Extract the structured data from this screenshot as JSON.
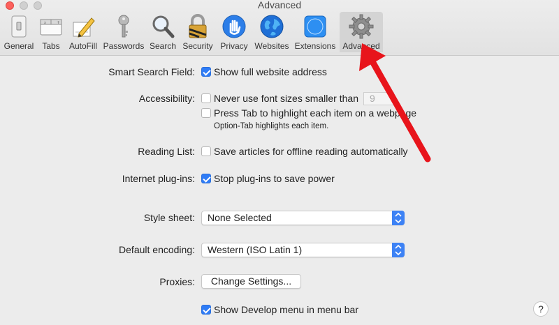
{
  "window": {
    "title": "Advanced"
  },
  "toolbar": {
    "tabs": [
      {
        "label": "General",
        "icon": "general-switch-icon"
      },
      {
        "label": "Tabs",
        "icon": "tabs-icon"
      },
      {
        "label": "AutoFill",
        "icon": "autofill-pencil-icon"
      },
      {
        "label": "Passwords",
        "icon": "key-icon"
      },
      {
        "label": "Search",
        "icon": "magnifier-icon"
      },
      {
        "label": "Security",
        "icon": "lock-icon"
      },
      {
        "label": "Privacy",
        "icon": "hand-icon"
      },
      {
        "label": "Websites",
        "icon": "globe-icon"
      },
      {
        "label": "Extensions",
        "icon": "puzzle-compass-icon"
      },
      {
        "label": "Advanced",
        "icon": "gear-icon",
        "active": true
      }
    ]
  },
  "settings": {
    "smart_search": {
      "label": "Smart Search Field:",
      "option": "Show full website address",
      "checked": true
    },
    "accessibility": {
      "label": "Accessibility:",
      "font_option": "Never use font sizes smaller than",
      "font_size": "9",
      "font_checked": false,
      "tab_option": "Press Tab to highlight each item on a webpage",
      "tab_checked": false,
      "tab_note": "Option-Tab highlights each item."
    },
    "reading_list": {
      "label": "Reading List:",
      "option": "Save articles for offline reading automatically",
      "checked": false
    },
    "plugins": {
      "label": "Internet plug-ins:",
      "option": "Stop plug-ins to save power",
      "checked": true
    },
    "style_sheet": {
      "label": "Style sheet:",
      "value": "None Selected"
    },
    "encoding": {
      "label": "Default encoding:",
      "value": "Western (ISO Latin 1)"
    },
    "proxies": {
      "label": "Proxies:",
      "button": "Change Settings..."
    },
    "develop": {
      "option": "Show Develop menu in menu bar",
      "checked": true
    }
  },
  "help": {
    "label": "?"
  },
  "colors": {
    "accent": "#2f7cf6",
    "arrow": "#e8141b"
  }
}
